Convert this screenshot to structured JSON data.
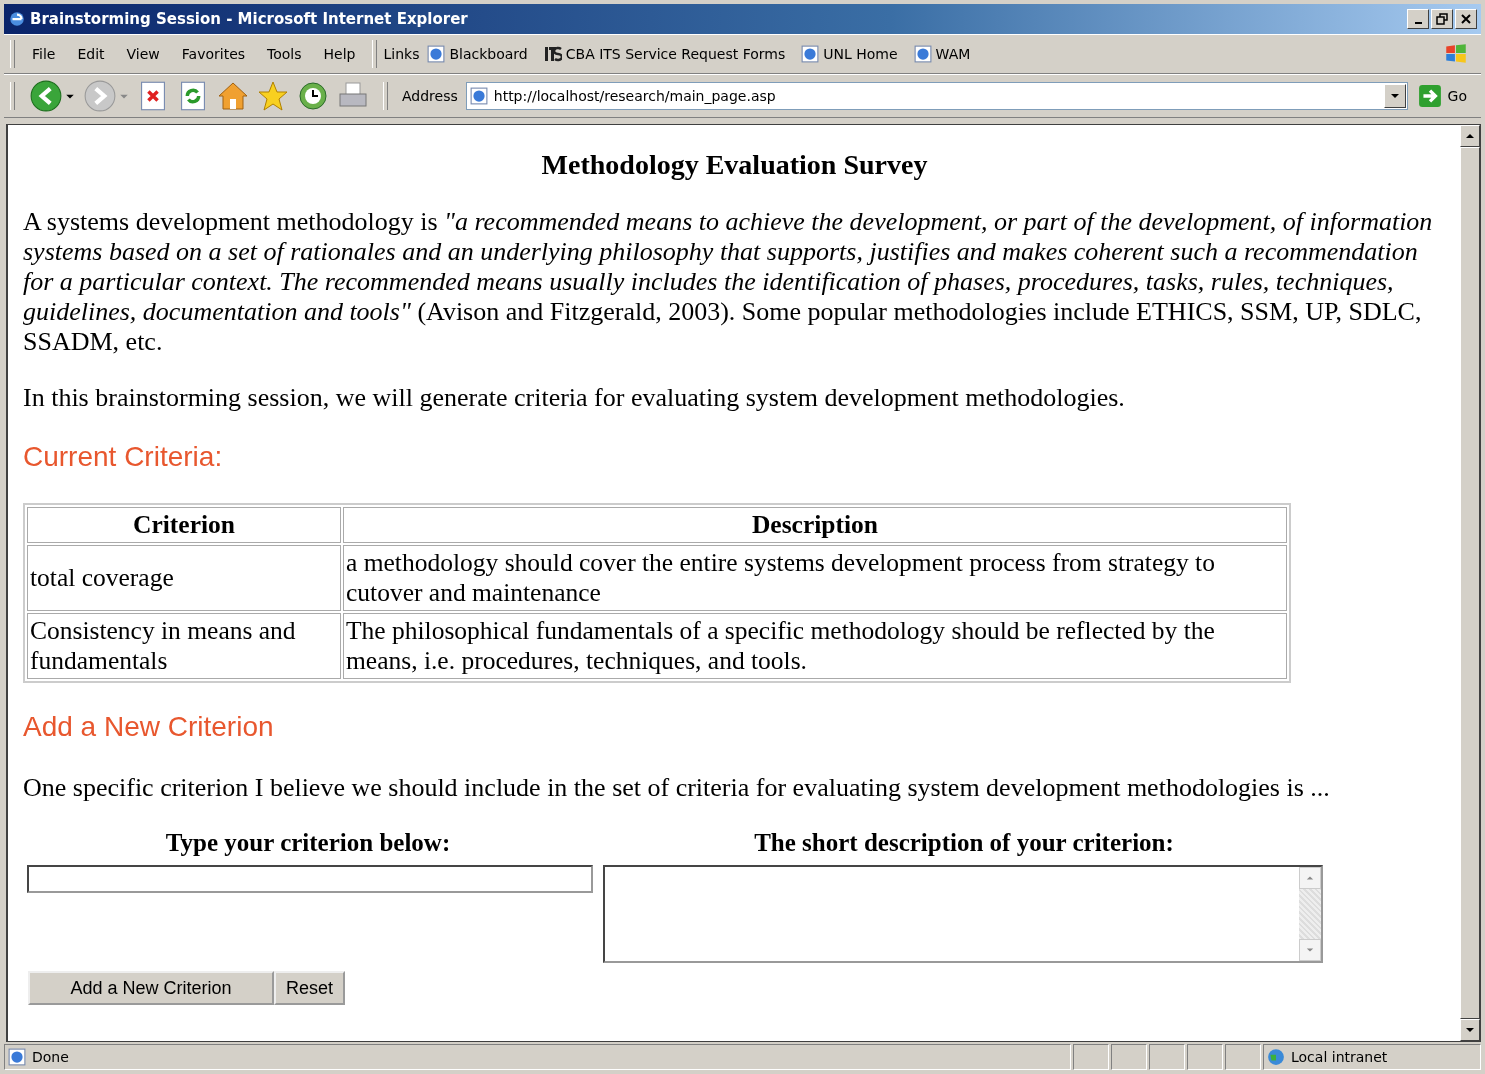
{
  "window": {
    "title": "Brainstorming Session - Microsoft Internet Explorer"
  },
  "menu_bar": {
    "items": [
      "File",
      "Edit",
      "View",
      "Favorites",
      "Tools",
      "Help"
    ]
  },
  "links_bar": {
    "label": "Links",
    "items": [
      {
        "label": "Blackboard",
        "kind": "page"
      },
      {
        "label": "CBA ITS Service Request Forms",
        "kind": "logo"
      },
      {
        "label": "UNL Home",
        "kind": "page"
      },
      {
        "label": "WAM",
        "kind": "page"
      }
    ]
  },
  "address_bar": {
    "label": "Address",
    "value": "http://localhost/research/main_page.asp",
    "go": "Go"
  },
  "page": {
    "heading": "Methodology Evaluation Survey",
    "intro": "A systems development methodology is *\"a recommended means to achieve the development, or part of the development, of information systems based on a set of rationales and an underlying philosophy that supports, justifies and makes coherent such a recommendation for a particular context. The recommended means usually includes the identification of phases, procedures, tasks, rules, techniques, guidelines, documentation and tools\"* (Avison and Fitzgerald, 2003). Some popular methodologies include ETHICS, SSM, UP, SDLC, SSADM, etc.",
    "session_text": "In this brainstorming session, we will generate criteria for evaluating system development methodologies.",
    "current_heading": "Current Criteria:",
    "table": {
      "columns": [
        "Criterion",
        "Description"
      ],
      "rows": [
        [
          "total coverage",
          "a methodology should cover the entire systems development process from strategy to cutover and maintenance"
        ],
        [
          "Consistency in means and fundamentals",
          "The philosophical fundamentals of a specific methodology should be reflected by the means, i.e. procedures, techniques, and tools."
        ]
      ]
    },
    "add_heading": "Add a New Criterion",
    "prompt": "One specific criterion I believe we should include in the set of criteria for evaluating system development methodologies is ...",
    "form": {
      "criterion_label": "Type your criterion below:",
      "description_label": "The short description of your criterion:",
      "buttons": [
        "Add a New Criterion",
        "Reset"
      ]
    }
  },
  "status_bar": {
    "text": "Done",
    "zone": "Local intranet"
  }
}
